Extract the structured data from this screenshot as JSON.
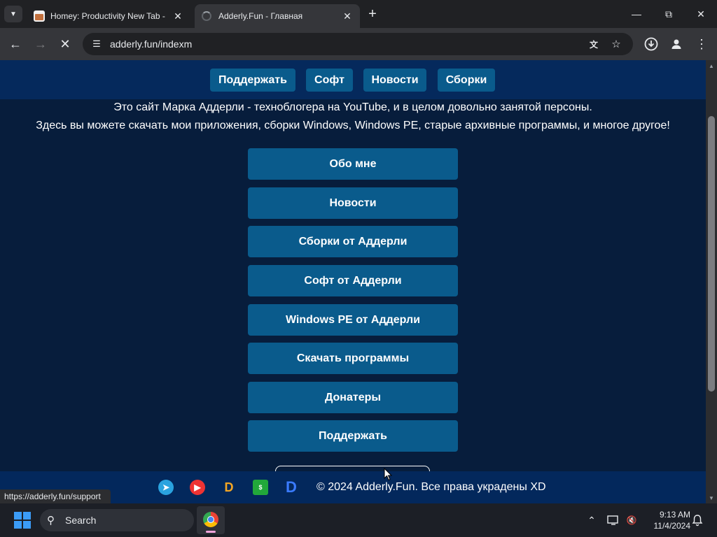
{
  "browser": {
    "tabs": [
      {
        "title": "Homey: Productivity New Tab -",
        "active": false
      },
      {
        "title": "Adderly.Fun - Главная",
        "active": true
      }
    ],
    "url": "adderly.fun/indexm",
    "status_url": "https://adderly.fun/support"
  },
  "page": {
    "nav": [
      "Поддержать",
      "Софт",
      "Новости",
      "Сборки"
    ],
    "intro_line1": "Это сайт Марка Аддерли - техноблогера на YouTube, и в целом довольно занятой персоны.",
    "intro_line2": "Здесь вы можете скачать мои приложения, сборки Windows, Windows PE, старые архивные программы, и многое другое!",
    "menu": [
      "Обо мне",
      "Новости",
      "Сборки от Аддерли",
      "Софт от Аддерли",
      "Windows PE от Аддерли",
      "Скачать программы",
      "Донатеры",
      "Поддержать"
    ],
    "footer_text": "© 2024 Adderly.Fun. Все права украдены XD"
  },
  "taskbar": {
    "search_label": "Search",
    "time": "9:13 AM",
    "date": "11/4/2024"
  },
  "colors": {
    "page_bg": "#071d3c",
    "nav_bg": "#05295c",
    "button_bg": "#0a5b8c"
  }
}
